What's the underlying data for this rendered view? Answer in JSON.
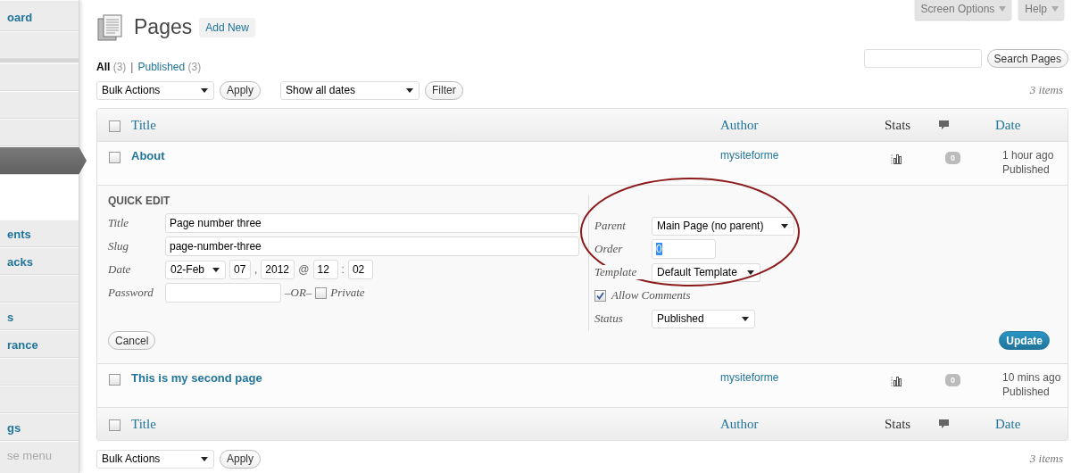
{
  "sidebar": {
    "items": [
      {
        "label": "oard",
        "kind": "item",
        "selected": false
      },
      {
        "kind": "item",
        "selected": false
      },
      {
        "kind": "separator"
      },
      {
        "kind": "item",
        "selected": false
      },
      {
        "kind": "item",
        "selected": false
      },
      {
        "kind": "item",
        "selected": false
      },
      {
        "kind": "item",
        "selected": true
      },
      {
        "kind": "submenu"
      },
      {
        "label": "ents",
        "kind": "item",
        "selected": false
      },
      {
        "label": "acks",
        "kind": "item",
        "selected": false
      },
      {
        "kind": "item",
        "selected": false
      },
      {
        "label": "s",
        "kind": "item",
        "selected": false
      },
      {
        "label": "rance",
        "kind": "item",
        "selected": false
      },
      {
        "kind": "item",
        "selected": false
      },
      {
        "kind": "item",
        "selected": false
      },
      {
        "label": "gs",
        "kind": "item",
        "selected": false
      },
      {
        "label": "se menu",
        "kind": "collapse"
      }
    ]
  },
  "top_tabs": [
    {
      "label": "Screen Options"
    },
    {
      "label": "Help"
    }
  ],
  "header": {
    "title": "Pages",
    "add_new": "Add New"
  },
  "views": [
    {
      "label": "All",
      "count": "(3)",
      "selected": true
    },
    {
      "label": "Published",
      "count": "(3)",
      "selected": false
    }
  ],
  "view_separator": "|",
  "search": {
    "button": "Search Pages"
  },
  "toolbar": {
    "bulk_actions": "Bulk Actions",
    "apply": "Apply",
    "dates": "Show all dates",
    "filter": "Filter",
    "count": "3 items"
  },
  "table": {
    "header_checked": false,
    "columns": [
      {
        "title": "Title",
        "kind": "sortable"
      },
      {
        "title": "Author",
        "kind": "sortable"
      },
      {
        "title": "Stats",
        "kind": "plain"
      },
      {
        "kind": "comments"
      },
      {
        "title": "Date",
        "kind": "sortable"
      }
    ],
    "rows": [
      {
        "title": "About",
        "author": "mysiteforme",
        "comments": "0",
        "date": "1 hour ago",
        "status": "Published",
        "checked": false
      },
      {
        "title": "This is my second page",
        "author": "mysiteforme",
        "comments": "0",
        "date": "10 mins ago",
        "status": "Published",
        "checked": false
      }
    ],
    "footer_checked": false,
    "footer_columns": [
      {
        "title": "Title",
        "kind": "sortable"
      },
      {
        "title": "Author",
        "kind": "sortable"
      },
      {
        "title": "Stats",
        "kind": "plain"
      },
      {
        "kind": "comments"
      },
      {
        "title": "Date",
        "kind": "sortable"
      }
    ]
  },
  "quick_edit": {
    "heading": "QUICK EDIT",
    "title_label": "Title",
    "title_value": "Page number three",
    "slug_label": "Slug",
    "slug_value": "page-number-three",
    "date_label": "Date",
    "month": "02-Feb",
    "day": "07",
    "comma": ",",
    "year": "2012",
    "at": "@",
    "hour": "12",
    "colon": ":",
    "minute": "02",
    "password_label": "Password",
    "or": "–OR–",
    "private_label": "Private",
    "private_checked": false,
    "parent_label": "Parent",
    "parent": "Main Page (no parent)",
    "order_label": "Order",
    "order": "0",
    "template_label": "Template",
    "template": "Default Template",
    "allow_comments_label": "Allow Comments",
    "allow_comments_checked": true,
    "status_label": "Status",
    "status": "Published",
    "cancel": "Cancel",
    "update": "Update"
  },
  "bottom_toolbar": {
    "bulk_actions": "Bulk Actions",
    "apply": "Apply",
    "count": "3 items"
  }
}
